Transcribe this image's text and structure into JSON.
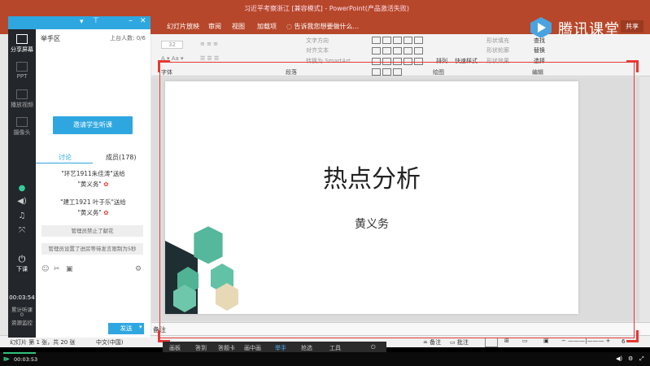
{
  "ppt": {
    "window_title": "习近平考察浙江 [兼容模式] - PowerPoint(产品激活失败)",
    "tabs": [
      "幻灯片放映",
      "审阅",
      "视图",
      "加载项"
    ],
    "tell_me": "告诉我您想要做什么...",
    "share": "共享",
    "groups": [
      "字体",
      "段落",
      "绘图",
      "编辑"
    ],
    "ribbon": {
      "font_size": "32",
      "text_direction": "文字方向",
      "align_text": "对齐文本",
      "smartart": "转换为 SmartArt",
      "arrange": "排列",
      "quick_styles": "快速样式",
      "shape_fill": "形状填充",
      "shape_outline": "形状轮廓",
      "shape_effects": "形状效果",
      "find": "查找",
      "replace": "替换",
      "select": "选择"
    },
    "slide": {
      "title": "热点分析",
      "author": "黄义务"
    },
    "notes_label": "备注",
    "status": {
      "slide_info": "幻灯片 第 1 张，共 20 张",
      "language": "中文(中国)",
      "notes": "备注",
      "comments": "批注",
      "zoom": "6"
    },
    "bottom_tools": [
      "画板",
      "答到",
      "答题卡",
      "画中画",
      "举手",
      "抢选",
      "工具"
    ]
  },
  "logo": {
    "text": "腾讯课堂"
  },
  "panel": {
    "room": "举手区",
    "stage_count": "上台人数: 0/6",
    "invite_button": "邀请学生听课",
    "tab_discussion": "讨论",
    "tab_members": "成员(178)",
    "messages": [
      {
        "line1": "\"环艺1911朱佳涛\"送给",
        "line2": "\"黄义务\""
      },
      {
        "line1": "\"建工1921 叶于乐\"送给",
        "line2": "\"黄义务\""
      }
    ],
    "notice1": "管理员禁止了献花",
    "notice2": "管理员设置了进房等待发言限制为5秒",
    "send": "发送",
    "sidebar": {
      "share_screen": "分享屏幕",
      "ppt": "PPT",
      "play_video": "播放视频",
      "camera": "摄像头",
      "end_class": "下课",
      "time": "00:03:54",
      "accumulated": "累计听课",
      "count": "0",
      "resource": "资源监控"
    }
  },
  "player": {
    "time": "00:03:53",
    "progress": 0.05
  }
}
